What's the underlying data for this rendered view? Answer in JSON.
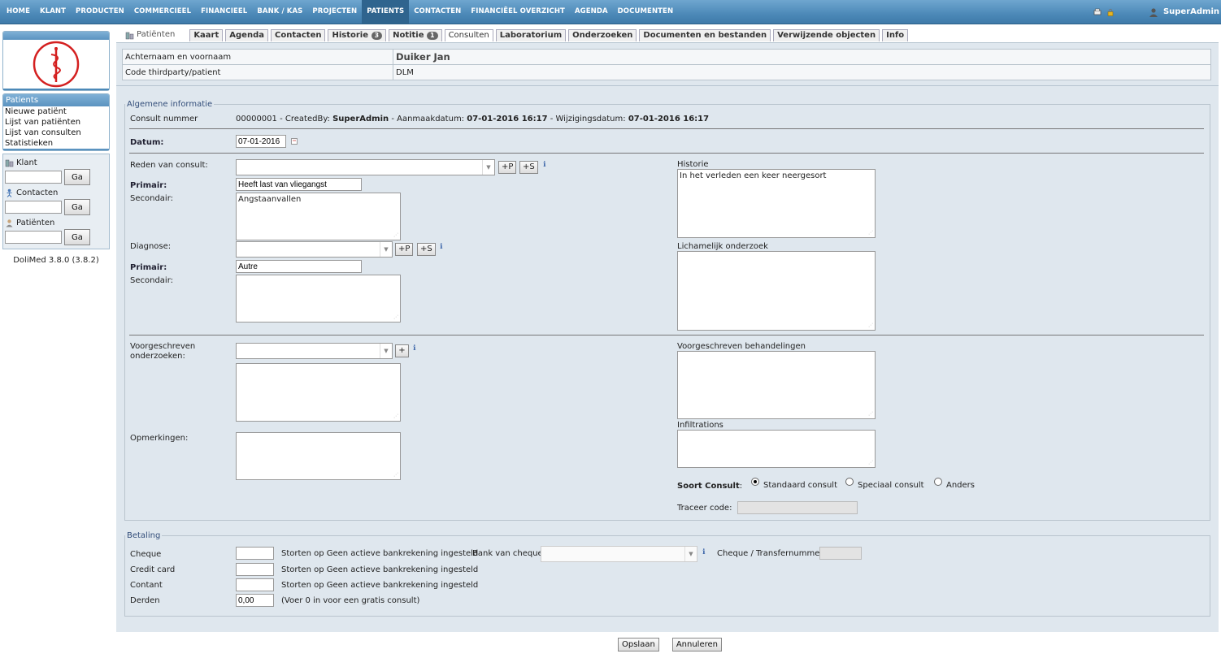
{
  "topnav": {
    "items": [
      "HOME",
      "KLANT",
      "PRODUCTEN",
      "COMMERCIEEL",
      "FINANCIEEL",
      "BANK / KAS",
      "PROJECTEN",
      "PATIENTS",
      "CONTACTEN",
      "FINANCIËEL OVERZICHT",
      "AGENDA",
      "DOCUMENTEN"
    ],
    "active": "PATIENTS",
    "user": "SuperAdmin"
  },
  "sidebar": {
    "nav_title": "Patients",
    "nav_items": [
      "Nieuwe patiënt",
      "Lijst van patiënten",
      "Lijst van consulten",
      "Statistieken"
    ],
    "search": {
      "klant_label": "Klant",
      "contacten_label": "Contacten",
      "patienten_label": "Patiënten",
      "go_label": "Ga"
    },
    "version": "DoliMed 3.8.0 (3.8.2)"
  },
  "tabs": {
    "first": "Patiënten",
    "items": [
      {
        "label": "Kaart"
      },
      {
        "label": "Agenda"
      },
      {
        "label": "Contacten"
      },
      {
        "label": "Historie",
        "badge": "3"
      },
      {
        "label": "Notitie",
        "badge": "1"
      },
      {
        "label": "Consulten",
        "active": true
      },
      {
        "label": "Laboratorium"
      },
      {
        "label": "Onderzoeken"
      },
      {
        "label": "Documenten en bestanden"
      },
      {
        "label": "Verwijzende objecten"
      },
      {
        "label": "Info"
      }
    ]
  },
  "patient": {
    "name_label": "Achternaam en voornaam",
    "name_value": "Duiker Jan",
    "code_label": "Code thirdparty/patient",
    "code_value": "DLM"
  },
  "general": {
    "legend": "Algemene informatie",
    "consult_nr_label": "Consult nummer",
    "consult_nr": "00000001",
    "created_by_label": "- CreatedBy:",
    "created_by": "SuperAdmin",
    "created_date_label": "- Aanmaakdatum:",
    "created_date": "07-01-2016 16:17",
    "modified_date_label": "- Wijzigingsdatum:",
    "modified_date": "07-01-2016 16:17",
    "date_label": "Datum:",
    "date_value": "07-01-2016",
    "reason_label": "Reden van consult:",
    "primary_label": "Primair:",
    "reason_primary": "Heeft last van vliegangst",
    "secondary_label": "Secondair:",
    "reason_secondary": "Angstaanvallen",
    "diagnose_label": "Diagnose:",
    "diag_primary": "Autre",
    "btn_p": "+P",
    "btn_s": "+S",
    "btn_plus": "+",
    "exams_label_1": "Voorgeschreven",
    "exams_label_2": "onderzoeken:",
    "remarks_label": "Opmerkingen:",
    "history_label": "Historie",
    "history_value": "In het verleden een keer neergesort",
    "physical_label": "Lichamelijk onderzoek",
    "treatments_label": "Voorgeschreven behandelingen",
    "infiltrations_label": "Infiltrations",
    "consult_type_label": "Soort Consult",
    "consult_types": [
      "Standaard consult",
      "Speciaal consult",
      "Anders"
    ],
    "trace_label": "Traceer code:"
  },
  "payment": {
    "legend": "Betaling",
    "cheque_label": "Cheque",
    "credit_label": "Credit card",
    "cash_label": "Contant",
    "third_label": "Derden",
    "third_value": "0,00",
    "deposit_text": "Storten op Geen actieve bankrekening ingesteld",
    "bank_label": "Bank van cheque",
    "transfer_label": "Cheque / Transfernummer",
    "free_hint": "(Voer 0 in voor een gratis consult)"
  },
  "actions": {
    "save": "Opslaan",
    "cancel": "Annuleren"
  }
}
